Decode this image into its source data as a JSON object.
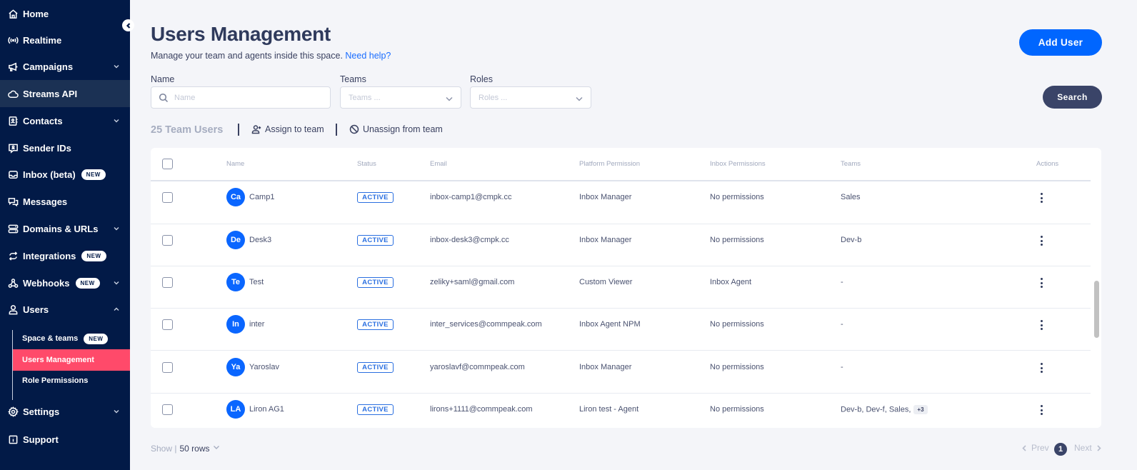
{
  "sidebar": {
    "collapse_icon": "chevron-left-icon",
    "items": [
      {
        "label": "Home",
        "icon": "home-icon"
      },
      {
        "label": "Realtime",
        "icon": "broadcast-icon"
      },
      {
        "label": "Campaigns",
        "icon": "megaphone-icon",
        "expandable": true
      },
      {
        "label": "Streams API",
        "icon": "cloud-icon",
        "highlighted": true
      },
      {
        "label": "Contacts",
        "icon": "contact-card-icon",
        "expandable": true
      },
      {
        "label": "Sender IDs",
        "icon": "sender-id-icon"
      },
      {
        "label": "Inbox (beta)",
        "icon": "inbox-icon",
        "badge": "NEW"
      },
      {
        "label": "Messages",
        "icon": "messages-icon"
      },
      {
        "label": "Domains & URLs",
        "icon": "server-icon",
        "expandable": true
      },
      {
        "label": "Integrations",
        "icon": "sync-icon",
        "badge": "NEW"
      },
      {
        "label": "Webhooks",
        "icon": "webhook-icon",
        "badge": "NEW",
        "expandable": true
      },
      {
        "label": "Users",
        "icon": "user-icon",
        "expanded": true
      },
      {
        "label": "Settings",
        "icon": "gear-icon",
        "expandable": true
      },
      {
        "label": "Support",
        "icon": "support-icon"
      }
    ],
    "users_sub": [
      {
        "label": "Space & teams",
        "badge": "NEW"
      },
      {
        "label": "Users Management",
        "active": true
      },
      {
        "label": "Role Permissions"
      }
    ],
    "colors": {
      "background": "#021a47",
      "active": "#ff4a6a"
    }
  },
  "header": {
    "title": "Users Management",
    "subtitle": "Manage your team and agents inside this space.",
    "help_link": "Need help?",
    "add_user_label": "Add User"
  },
  "filters": {
    "name_label": "Name",
    "name_placeholder": "Name",
    "name_value": "",
    "teams_label": "Teams",
    "teams_placeholder": "Teams ...",
    "roles_label": "Roles",
    "roles_placeholder": "Roles ...",
    "search_label": "Search"
  },
  "toolbar": {
    "count_label": "25 Team Users",
    "assign_label": "Assign to team",
    "unassign_label": "Unassign from team"
  },
  "table": {
    "columns": [
      "Name",
      "Status",
      "Email",
      "Platform Permission",
      "Inbox Permissions",
      "Teams",
      "Actions"
    ],
    "rows": [
      {
        "initials": "Ca",
        "name": "Camp1",
        "status": "ACTIVE",
        "email": "inbox-camp1@cmpk.cc",
        "platform": "Inbox Manager",
        "inbox": "No permissions",
        "teams": "Sales",
        "more": ""
      },
      {
        "initials": "De",
        "name": "Desk3",
        "status": "ACTIVE",
        "email": "inbox-desk3@cmpk.cc",
        "platform": "Inbox Manager",
        "inbox": "No permissions",
        "teams": "Dev-b",
        "more": ""
      },
      {
        "initials": "Te",
        "name": "Test",
        "status": "ACTIVE",
        "email": "zeliky+saml@gmail.com",
        "platform": "Custom Viewer",
        "inbox": "Inbox Agent",
        "teams": "-",
        "more": ""
      },
      {
        "initials": "In",
        "name": "inter",
        "status": "ACTIVE",
        "email": "inter_services@commpeak.com",
        "platform": "Inbox Agent NPM",
        "inbox": "No permissions",
        "teams": "-",
        "more": ""
      },
      {
        "initials": "Ya",
        "name": "Yaroslav",
        "status": "ACTIVE",
        "email": "yaroslavf@commpeak.com",
        "platform": "Inbox Manager",
        "inbox": "No permissions",
        "teams": "-",
        "more": ""
      },
      {
        "initials": "LA",
        "name": "Liron AG1",
        "status": "ACTIVE",
        "email": "lirons+1111@commpeak.com",
        "platform": "Liron test - Agent",
        "inbox": "No permissions",
        "teams": "Dev-b, Dev-f, Sales,",
        "more": "+3"
      }
    ]
  },
  "footer": {
    "show_label": "Show |",
    "rows_value": "50 rows",
    "prev_label": "Prev",
    "current_page": "1",
    "next_label": "Next"
  },
  "colors": {
    "primary": "#0066ff",
    "dark_button": "#3a4468",
    "status_active": "#2a6fe0"
  }
}
